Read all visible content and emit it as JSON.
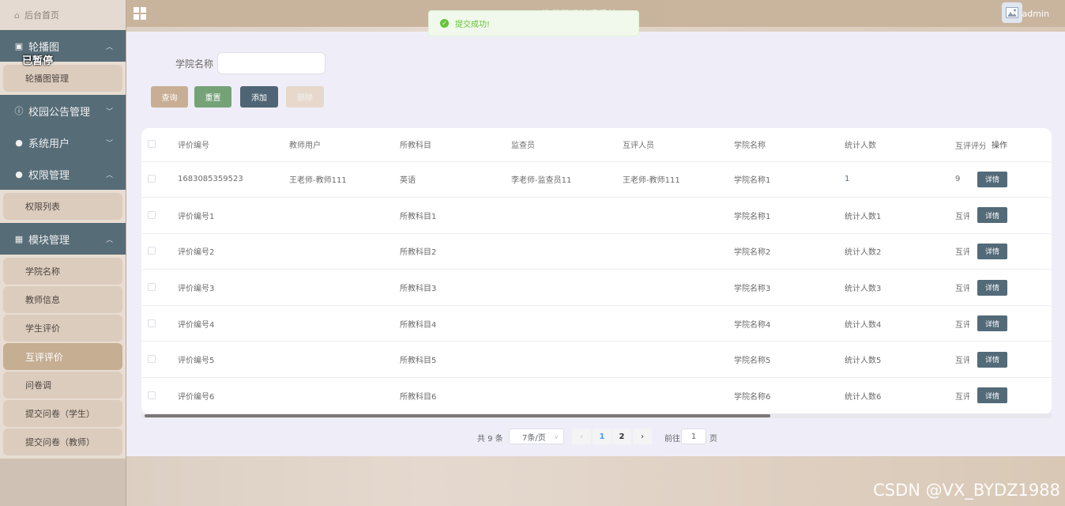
{
  "sidebar": {
    "home": "后台首页",
    "paused_overlay": "已暂停",
    "groups": [
      {
        "label": "轮播图",
        "icon": "image-icon",
        "expanded": true,
        "items": [
          "轮播图管理"
        ]
      },
      {
        "label": "校园公告管理",
        "icon": "info-icon",
        "expanded": false,
        "items": []
      },
      {
        "label": "系统用户",
        "icon": "user-icon",
        "expanded": false,
        "items": []
      },
      {
        "label": "权限管理",
        "icon": "user-icon",
        "expanded": true,
        "items": [
          "权限列表"
        ]
      },
      {
        "label": "模块管理",
        "icon": "grid-icon",
        "expanded": true,
        "items": [
          "学院名称",
          "教师信息",
          "学生评价",
          "互评评价",
          "问卷调",
          "提交问卷（学生）",
          "提交问卷（教师）"
        ]
      }
    ],
    "active_item": "互评评价"
  },
  "header": {
    "title": "教师互评管理系统",
    "user": "admin"
  },
  "toast": {
    "message": "提交成功!"
  },
  "search": {
    "label": "学院名称",
    "value": "",
    "buttons": {
      "query": "查询",
      "reset": "重置",
      "add": "添加",
      "delete": "删除"
    }
  },
  "table": {
    "columns": [
      "评价编号",
      "教师用户",
      "所教科目",
      "监查员",
      "互评人员",
      "学院名称",
      "统计人数",
      "互评评分",
      "操作"
    ],
    "detail_label": "详情",
    "rows": [
      [
        "1683085359523",
        "王老师-教师111",
        "英语",
        "李老师-监查员11",
        "王老师-教师111",
        "学院名称1",
        "1",
        "9"
      ],
      [
        "评价编号1",
        "",
        "所教科目1",
        "",
        "",
        "学院名称1",
        "统计人数1",
        "互评评分"
      ],
      [
        "评价编号2",
        "",
        "所教科目2",
        "",
        "",
        "学院名称2",
        "统计人数2",
        "互评评分"
      ],
      [
        "评价编号3",
        "",
        "所教科目3",
        "",
        "",
        "学院名称3",
        "统计人数3",
        "互评评分"
      ],
      [
        "评价编号4",
        "",
        "所教科目4",
        "",
        "",
        "学院名称4",
        "统计人数4",
        "互评评分"
      ],
      [
        "评价编号5",
        "",
        "所教科目5",
        "",
        "",
        "学院名称5",
        "统计人数5",
        "互评评分"
      ],
      [
        "评价编号6",
        "",
        "所教科目6",
        "",
        "",
        "学院名称6",
        "统计人数6",
        "互评评分"
      ]
    ]
  },
  "pagination": {
    "total": "共 9 条",
    "page_size": "7条/页",
    "pages": [
      "1",
      "2"
    ],
    "current": "1",
    "goto_label": "前往",
    "goto_value": "1",
    "goto_unit": "页"
  },
  "watermark": "CSDN @VX_BYDZ1988"
}
